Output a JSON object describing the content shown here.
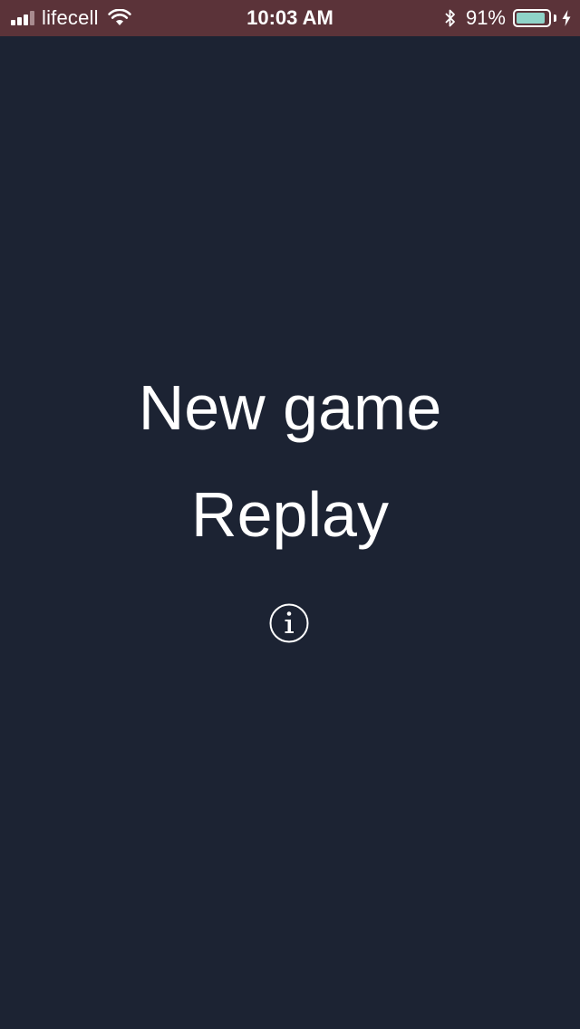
{
  "status_bar": {
    "carrier": "lifecell",
    "time": "10:03 AM",
    "battery_percent_text": "91%",
    "battery_level": 0.91,
    "signal_bars": 4,
    "signal_bars_active": 3,
    "icons": [
      "wifi-icon",
      "bluetooth-icon",
      "battery-icon",
      "charging-bolt-icon"
    ]
  },
  "menu": {
    "new_game_label": "New game",
    "replay_label": "Replay",
    "info_icon": "info-icon"
  },
  "colors": {
    "background": "#1c2333",
    "status_bar": "#5b3339",
    "text": "#ffffff",
    "battery_fill": "#8fd3c8"
  }
}
